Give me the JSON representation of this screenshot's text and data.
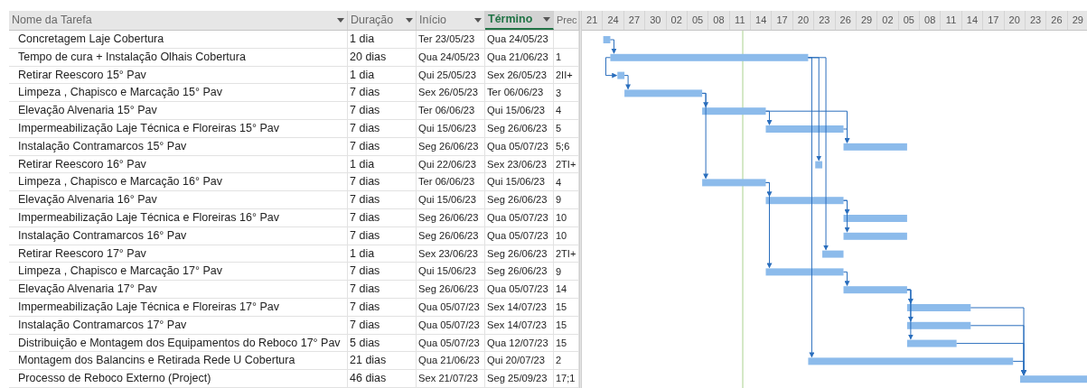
{
  "columns": [
    {
      "label": "Nome da Tarefa",
      "selected": false,
      "dropdown": true
    },
    {
      "label": "Duração",
      "selected": false,
      "dropdown": true
    },
    {
      "label": "Início",
      "selected": false,
      "dropdown": true
    },
    {
      "label": "Término",
      "selected": true,
      "dropdown": true
    },
    {
      "label": "Prec",
      "selected": false,
      "dropdown": false
    }
  ],
  "timescale": {
    "ticks": [
      "21",
      "24",
      "27",
      "30",
      "02",
      "05",
      "08",
      "11",
      "14",
      "17",
      "20",
      "23",
      "26",
      "29",
      "02",
      "05",
      "08",
      "11",
      "14",
      "17",
      "20",
      "23",
      "26",
      "29"
    ]
  },
  "tasks": [
    {
      "name": "Concretagem Laje Cobertura",
      "duration": "1 dia",
      "start": "Ter 23/05/23",
      "finish": "Qua 24/05/23"
    },
    {
      "name": "Tempo de cura + Instalação Olhais Cobertura",
      "duration": "20 dias",
      "start": "Qua 24/05/23",
      "finish": "Qua 21/06/23",
      "predecessors": "1"
    },
    {
      "name": "Retirar Reescoro 15° Pav",
      "duration": "1 dia",
      "start": "Qui 25/05/23",
      "finish": "Sex 26/05/23",
      "predecessors": "2II+"
    },
    {
      "name": "Limpeza , Chapisco e Marcação 15° Pav",
      "duration": "7 dias",
      "start": "Sex 26/05/23",
      "finish": "Ter 06/06/23",
      "predecessors": "3"
    },
    {
      "name": "Elevação Alvenaria 15° Pav",
      "duration": "7 dias",
      "start": "Ter 06/06/23",
      "finish": "Qui 15/06/23",
      "predecessors": "4"
    },
    {
      "name": "Impermeabilização Laje Técnica e Floreiras 15° Pav",
      "duration": "7 dias",
      "start": "Qui 15/06/23",
      "finish": "Seg 26/06/23",
      "predecessors": "5"
    },
    {
      "name": "Instalação Contramarcos 15° Pav",
      "duration": "7 dias",
      "start": "Seg 26/06/23",
      "finish": "Qua 05/07/23",
      "predecessors": "5;6"
    },
    {
      "name": "Retirar Reescoro 16° Pav",
      "duration": "1 dia",
      "start": "Qui 22/06/23",
      "finish": "Sex 23/06/23",
      "predecessors": "2TI+"
    },
    {
      "name": "Limpeza , Chapisco e Marcação 16° Pav",
      "duration": "7 dias",
      "start": "Ter 06/06/23",
      "finish": "Qui 15/06/23",
      "predecessors": "4"
    },
    {
      "name": "Elevação Alvenaria 16° Pav",
      "duration": "7 dias",
      "start": "Qui 15/06/23",
      "finish": "Seg 26/06/23",
      "predecessors": "9"
    },
    {
      "name": "Impermeabilização Laje Técnica e Floreiras 16° Pav",
      "duration": "7 dias",
      "start": "Seg 26/06/23",
      "finish": "Qua 05/07/23",
      "predecessors": "10"
    },
    {
      "name": "Instalação Contramarcos 16° Pav",
      "duration": "7 dias",
      "start": "Seg 26/06/23",
      "finish": "Qua 05/07/23",
      "predecessors": "10"
    },
    {
      "name": "Retirar Reescoro 17° Pav",
      "duration": "1 dia",
      "start": "Sex 23/06/23",
      "finish": "Seg 26/06/23",
      "predecessors": "2TI+"
    },
    {
      "name": "Limpeza , Chapisco e Marcação 17° Pav",
      "duration": "7 dias",
      "start": "Qui 15/06/23",
      "finish": "Seg 26/06/23",
      "predecessors": "9"
    },
    {
      "name": "Elevação Alvenaria 17° Pav",
      "duration": "7 dias",
      "start": "Seg 26/06/23",
      "finish": "Qua 05/07/23",
      "predecessors": "14"
    },
    {
      "name": "Impermeabilização Laje Técnica e Floreiras 17° Pav",
      "duration": "7 dias",
      "start": "Qua 05/07/23",
      "finish": "Sex 14/07/23",
      "predecessors": "15"
    },
    {
      "name": "Instalação Contramarcos 17° Pav",
      "duration": "7 dias",
      "start": "Qua 05/07/23",
      "finish": "Sex 14/07/23",
      "predecessors": "15"
    },
    {
      "name": "Distribuição e Montagem dos Equipamentos do Reboco 17° Pav",
      "duration": "5 dias",
      "start": "Qua 05/07/23",
      "finish": "Qua 12/07/23",
      "predecessors": "15"
    },
    {
      "name": "Montagem dos Balancins e Retirada Rede U Cobertura",
      "duration": "21 dias",
      "start": "Qua 21/06/23",
      "finish": "Qui 20/07/23",
      "predecessors": "2"
    },
    {
      "name": "Processo de Reboco Externo (Project)",
      "duration": "46 dias",
      "start": "Sex 21/07/23",
      "finish": "Seg 25/09/23",
      "predecessors": "17;1"
    }
  ]
}
